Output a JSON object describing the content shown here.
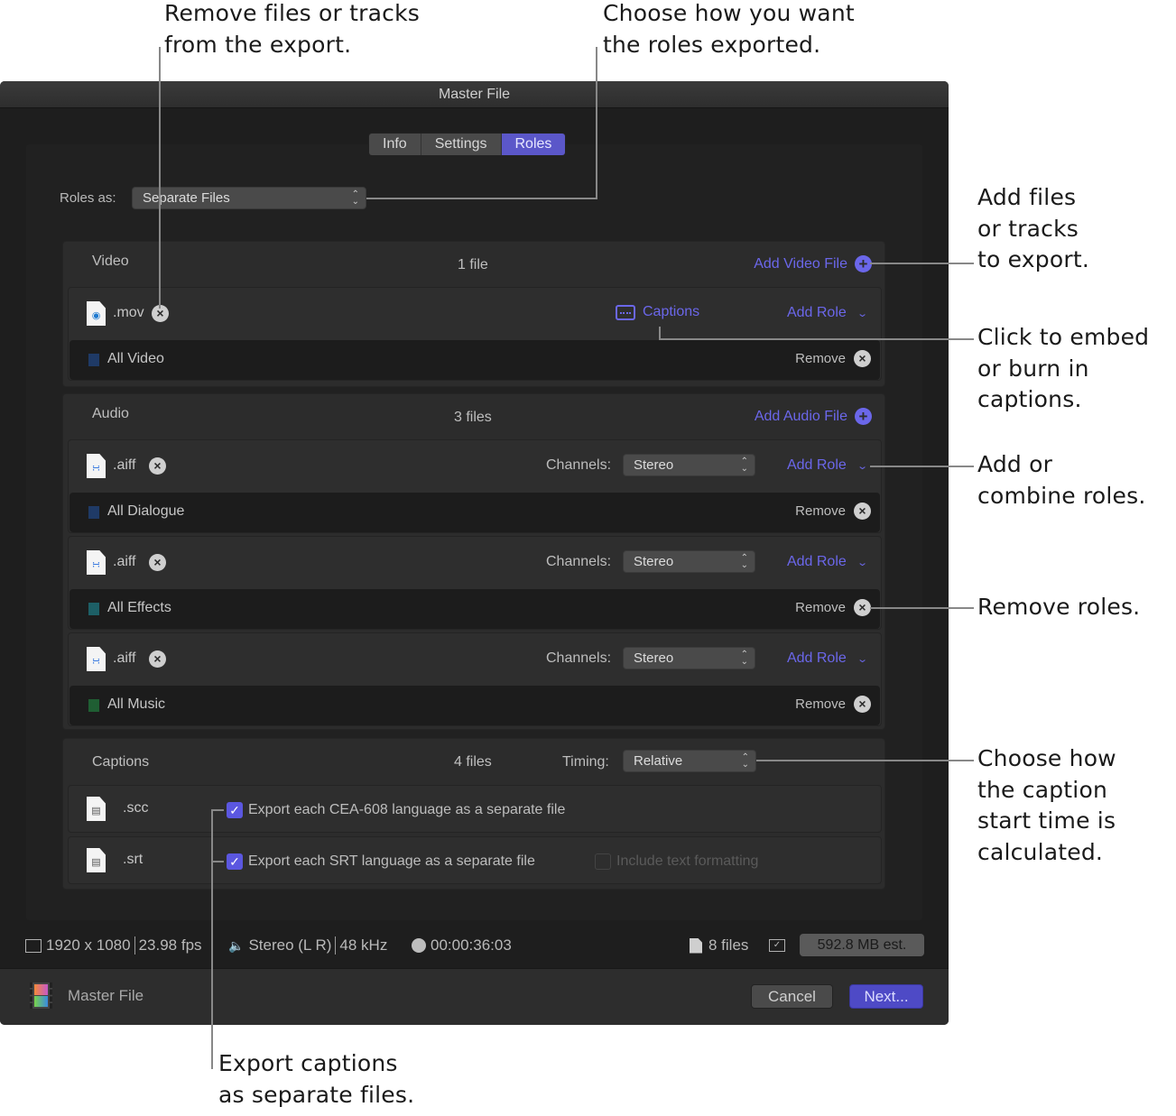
{
  "callouts": {
    "remove_files": "Remove files or tracks\nfrom the export.",
    "roles_exported": "Choose how you want\nthe roles exported.",
    "add_files": "Add files\nor tracks\nto export.",
    "embed_captions": "Click to embed\nor burn in\ncaptions.",
    "add_roles": "Add or\ncombine roles.",
    "remove_roles": "Remove roles.",
    "caption_timing": "Choose how\nthe caption\nstart time is\ncalculated.",
    "export_captions": "Export captions\nas separate files."
  },
  "window": {
    "title": "Master File",
    "tabs": [
      {
        "label": "Info",
        "active": false
      },
      {
        "label": "Settings",
        "active": false
      },
      {
        "label": "Roles",
        "active": true
      }
    ],
    "roles_as": {
      "label": "Roles as:",
      "value": "Separate Files"
    }
  },
  "video": {
    "title": "Video",
    "count": "1 file",
    "add_label": "Add Video File",
    "files": [
      {
        "ext": ".mov",
        "captions_label": "Captions",
        "add_role": "Add Role",
        "roles": [
          {
            "name": "All Video",
            "color": "#1f3a66",
            "remove": "Remove"
          }
        ]
      }
    ]
  },
  "audio": {
    "title": "Audio",
    "count": "3 files",
    "add_label": "Add Audio File",
    "channels_label": "Channels:",
    "files": [
      {
        "ext": ".aiff",
        "channels": "Stereo",
        "add_role": "Add Role",
        "roles": [
          {
            "name": "All Dialogue",
            "color": "#1f3a66",
            "remove": "Remove"
          }
        ]
      },
      {
        "ext": ".aiff",
        "channels": "Stereo",
        "add_role": "Add Role",
        "roles": [
          {
            "name": "All Effects",
            "color": "#1d5f66",
            "remove": "Remove"
          }
        ]
      },
      {
        "ext": ".aiff",
        "channels": "Stereo",
        "add_role": "Add Role",
        "roles": [
          {
            "name": "All Music",
            "color": "#1f5e33",
            "remove": "Remove"
          }
        ]
      }
    ]
  },
  "captions": {
    "title": "Captions",
    "count": "4 files",
    "timing_label": "Timing:",
    "timing_value": "Relative",
    "files": [
      {
        "ext": ".scc",
        "option": "Export each CEA-608 language as a separate file",
        "checked": true
      },
      {
        "ext": ".srt",
        "option": "Export each SRT language as a separate file",
        "checked": true,
        "extra_option": "Include text formatting",
        "extra_checked": false,
        "extra_enabled": false
      }
    ]
  },
  "status": {
    "resolution": "1920 x 1080",
    "fps": "23.98 fps",
    "audio": "Stereo (L R)",
    "sample_rate": "48 kHz",
    "duration": "00:00:36:03",
    "file_count": "8 files",
    "size_estimate": "592.8 MB est."
  },
  "footer": {
    "title": "Master File",
    "cancel": "Cancel",
    "next": "Next..."
  },
  "colors": {
    "accent": "#6b67ea",
    "active_tab": "#5b57c9",
    "window_bg": "#1e1e1e"
  }
}
